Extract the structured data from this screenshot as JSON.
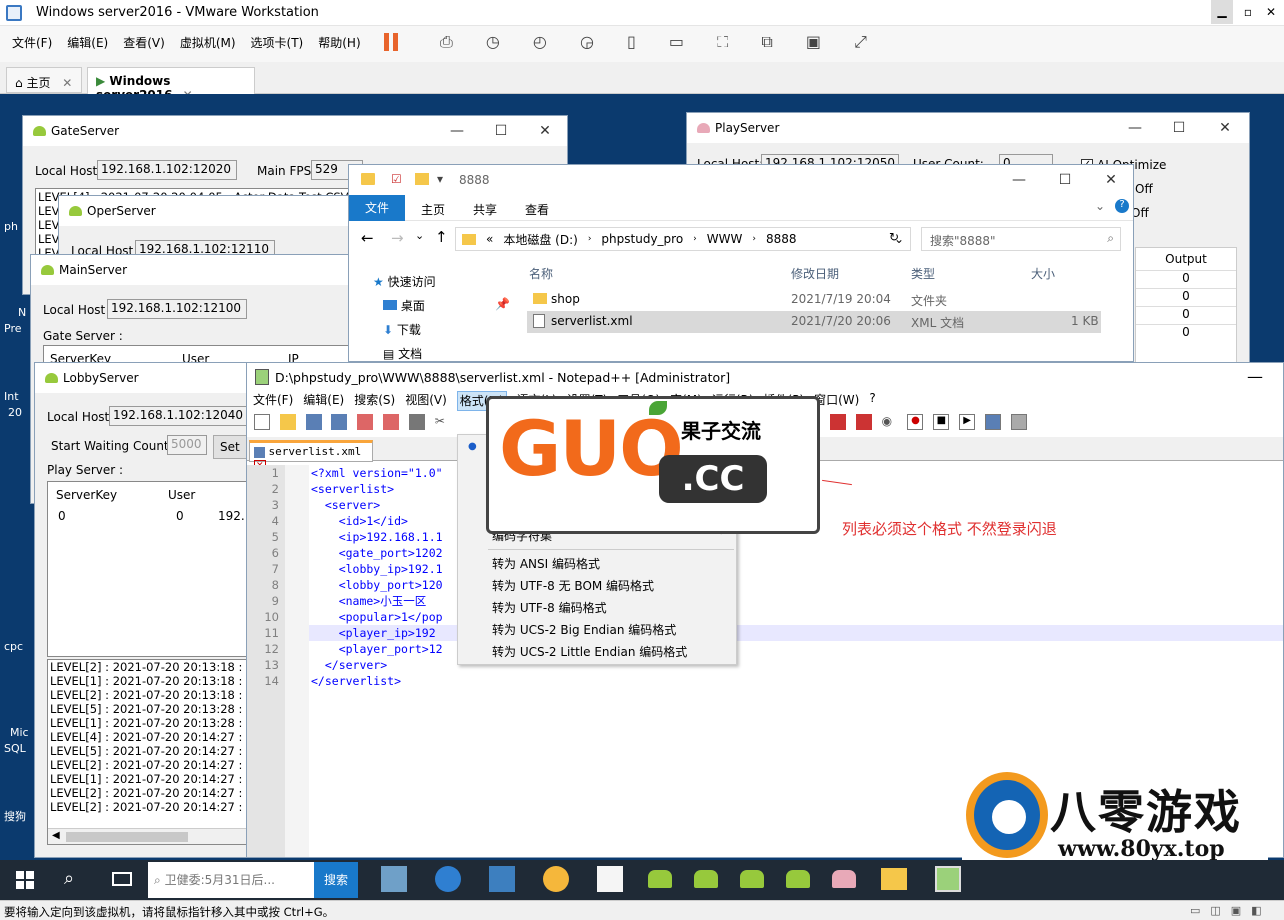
{
  "vmware": {
    "title": "Windows server2016 - VMware Workstation",
    "menus": [
      "文件(F)",
      "编辑(E)",
      "查看(V)",
      "虚拟机(M)",
      "选项卡(T)",
      "帮助(H)"
    ],
    "tabs": [
      "主页",
      "Windows server2016"
    ],
    "status": "要将输入定向到该虚拟机，请将鼠标指针移入其中或按 Ctrl+G。"
  },
  "desktop": {
    "side_labels": [
      "ph",
      "N",
      "Pre",
      "Int",
      "20",
      "cpc",
      "Mic",
      "SQL",
      "搜狗"
    ]
  },
  "gate": {
    "title": "GateServer",
    "local_host_label": "Local Host",
    "local_host": "192.168.1.102:12020",
    "fps_label": "Main FPS",
    "fps": "529",
    "log_first": "LEVEL[4] : 2021-07-20 20:04:05 : Actor Data Test CSV",
    "log_prefix": "LEV"
  },
  "oper": {
    "title": "OperServer",
    "local_host_label": "Local Host",
    "local_host": "192.168.1.102:12110"
  },
  "main": {
    "title": "MainServer",
    "local_host_label": "Local Host",
    "local_host": "192.168.1.102:12100",
    "gate_label": "Gate Server :",
    "cols": [
      "ServerKey",
      "User",
      "IP"
    ]
  },
  "lobby": {
    "title": "LobbyServer",
    "local_host_label": "Local Host",
    "local_host": "192.168.1.102:12040",
    "wait_label": "Start Waiting Count:",
    "wait_value": "5000",
    "set_label": "Set",
    "play_label": "Play Server :",
    "cols": [
      "ServerKey",
      "User"
    ],
    "row": [
      "0",
      "0",
      "192."
    ],
    "logs": [
      "LEVEL[2] : 2021-07-20 20:13:18 :",
      "LEVEL[1] : 2021-07-20 20:13:18 :",
      "LEVEL[2] : 2021-07-20 20:13:18 :",
      "LEVEL[5] : 2021-07-20 20:13:28 :",
      "LEVEL[1] : 2021-07-20 20:13:28 :",
      "LEVEL[4] : 2021-07-20 20:14:27 :",
      "LEVEL[5] : 2021-07-20 20:14:27 :",
      "LEVEL[2] : 2021-07-20 20:14:27 :",
      "LEVEL[1] : 2021-07-20 20:14:27 :",
      "LEVEL[2] : 2021-07-20 20:14:27 :",
      "LEVEL[2] : 2021-07-20 20:14:27 :"
    ]
  },
  "play": {
    "title": "PlayServer",
    "local_host_label": "Local Host:",
    "local_host": "192.168.1.102:12050",
    "user_count_label": "User Count:",
    "user_count": "0",
    "ai_label": "AI Optimize",
    "off1": "Off",
    "off2": "Off",
    "output_label": "Output",
    "outputs": [
      "0",
      "0",
      "0",
      "0"
    ]
  },
  "explorer": {
    "title": "8888",
    "ribbon": [
      "文件",
      "主页",
      "共享",
      "查看"
    ],
    "path": [
      "«",
      "本地磁盘 (D:)",
      "phpstudy_pro",
      "WWW",
      "8888"
    ],
    "search_placeholder": "搜索\"8888\"",
    "nav": [
      "快速访问",
      "桌面",
      "下载",
      "文档"
    ],
    "cols": [
      "名称",
      "修改日期",
      "类型",
      "大小"
    ],
    "files": [
      {
        "name": "shop",
        "date": "2021/7/19 20:04",
        "type": "文件夹",
        "size": ""
      },
      {
        "name": "serverlist.xml",
        "date": "2021/7/20 20:06",
        "type": "XML 文档",
        "size": "1 KB"
      }
    ]
  },
  "npp": {
    "title": "D:\\phpstudy_pro\\WWW\\8888\\serverlist.xml - Notepad++ [Administrator]",
    "menus": [
      "文件(F)",
      "编辑(E)",
      "搜索(S)",
      "视图(V)",
      "格式(M)",
      "语言(L)",
      "设置(T)",
      "工具(O)",
      "宏(M)",
      "运行(R)",
      "插件(P)",
      "窗口(W)",
      "?"
    ],
    "tab": "serverlist.xml",
    "line_numbers": [
      "1",
      "2",
      "3",
      "4",
      "5",
      "6",
      "7",
      "8",
      "9",
      "10",
      "11",
      "12",
      "13",
      "14"
    ],
    "lines": [
      "<?xml version=\"1.0\"",
      "<serverlist>",
      "  <server>",
      "    <id>1</id>",
      "    <ip>192.168.1.1",
      "    <gate_port>1202",
      "    <lobby_ip>192.1",
      "    <lobby_port>120",
      "    <name>小玉一区",
      "    <popular>1</pop",
      "    <player_ip>192",
      "    <player_port>12",
      "  </server>",
      "</serverlist>"
    ],
    "menu_partial": "编码字符集",
    "menu_items": [
      "转为 ANSI 编码格式",
      "转为 UTF-8 无 BOM 编码格式",
      "转为 UTF-8 编码格式",
      "转为 UCS-2 Big Endian 编码格式",
      "转为 UCS-2 Little Endian 编码格式"
    ]
  },
  "annotation": "列表必须这个格式 不然登录闪退",
  "watermark1": {
    "big": "GUO",
    "cc": ".CC",
    "tag": "果子交流"
  },
  "watermark2": {
    "title": "八零游戏",
    "url": "www.80yx.top"
  },
  "taskbar": {
    "search_placeholder": "卫健委:5月31日后...",
    "search_button": "搜索"
  }
}
